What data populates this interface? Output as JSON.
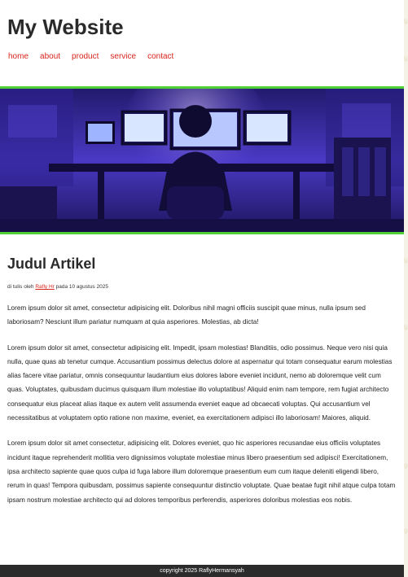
{
  "site": {
    "title": "My Website"
  },
  "nav": {
    "items": [
      {
        "label": "home"
      },
      {
        "label": "about"
      },
      {
        "label": "product"
      },
      {
        "label": "service"
      },
      {
        "label": "contact"
      }
    ]
  },
  "hero": {
    "alt": "anime character at computer desk"
  },
  "article": {
    "title": "Judul Artikel",
    "byline_prefix": "di tulis oleh ",
    "author": "Rafly Hr",
    "byline_suffix": " pada 10 agustus 2025",
    "paragraphs": [
      "Lorem ipsum dolor sit amet, consectetur adipisicing elit. Doloribus nihil magni officiis suscipit quae minus, nulla ipsum sed laboriosam? Nesciunt illum pariatur numquam at quia asperiores. Molestias, ab dicta!",
      "Lorem ipsum dolor sit amet, consectetur adipisicing elit. Impedit, ipsam molestias! Blanditiis, odio possimus. Neque vero nisi quia nulla, quae quas ab tenetur cumque. Accusantium possimus delectus dolore at aspernatur qui totam consequatur earum molestias alias facere vitae pariatur, omnis consequuntur laudantium eius dolores labore eveniet incidunt, nemo ab doloremque velit cum quas. Voluptates, quibusdam ducimus quisquam illum molestiae illo voluptatibus! Aliquid enim nam tempore, rem fugiat architecto consequatur eius placeat alias itaque ex autem velit assumenda eveniet eaque ad obcaecati voluptas. Qui accusantium vel necessitatibus at voluptatem optio ratione non maxime, eveniet, ea exercitationem adipisci illo laboriosam! Maiores, aliquid.",
      "Lorem ipsum dolor sit amet consectetur, adipisicing elit. Dolores eveniet, quo hic asperiores recusandae eius officiis voluptates incidunt itaque reprehenderit mollitia vero dignissimos voluptate molestiae minus libero praesentium sed adipisci! Exercitationem, ipsa architecto sapiente quae quos culpa id fuga labore illum doloremque praesentium eum cum itaque deleniti eligendi libero, rerum in quas! Tempora quibusdam, possimus sapiente consequuntur distinctio voluptate. Quae beatae fugit nihil atque culpa totam ipsam nostrum molestiae architecto qui ad dolores temporibus perferendis, asperiores doloribus molestias eos nobis."
    ]
  },
  "footer": {
    "text": "copyright 2025 RaflyHermansyah"
  },
  "colors": {
    "accent": "#4fd135",
    "link": "#d9241c",
    "footer_bg": "#2b2b2b"
  }
}
